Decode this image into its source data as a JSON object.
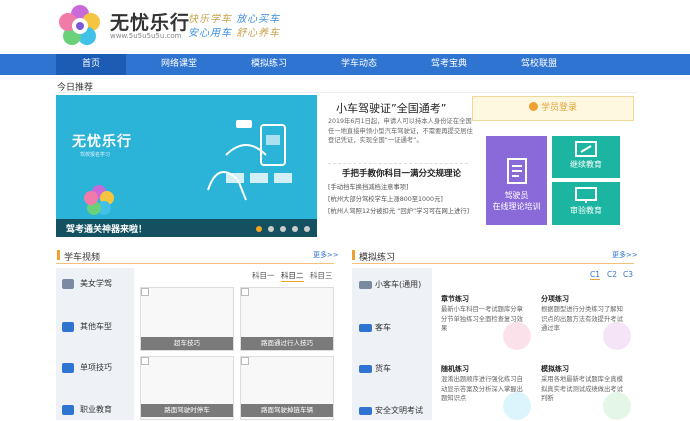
{
  "header": {
    "brand": "无忧乐行",
    "site": "www.5u5u5u5u.com",
    "slogan_line1_a": "快乐学车",
    "slogan_line1_b": "放心买车",
    "slogan_line2_a": "安心用车",
    "slogan_line2_b": "舒心养车"
  },
  "nav": {
    "items": [
      {
        "label": "首页"
      },
      {
        "label": "网络课堂"
      },
      {
        "label": "模拟练习"
      },
      {
        "label": "学车动态"
      },
      {
        "label": "驾考宝典"
      },
      {
        "label": "驾校联盟"
      }
    ]
  },
  "today": {
    "label": "今日推荐"
  },
  "banner": {
    "title": "无忧乐行",
    "subtitle": "驾校报名学习",
    "caption": "驾考通关神器来啦！"
  },
  "news": {
    "headline": "小车驾驶证”全国通考”",
    "summary": "2019年6月1日起，申请人可以持本人身份证在全国任一地直接申领小型汽车驾驶证，不需要再提交居住登记凭证，实现全国“一证通考”。",
    "headline2": "手把手教你科目一满分交规理论",
    "items": [
      "[手动挡车换挡减档注意事项]",
      "[杭州大部分驾校学车上涨800至1000元]",
      "[杭州人驾照12分被扣光 “回炉”学习可在网上进行]"
    ]
  },
  "login": {
    "label": "学员登录"
  },
  "tiles": {
    "a_line1": "驾驶员",
    "a_line2": "在线理论培训",
    "b": "继续教育",
    "c": "审验教育"
  },
  "video": {
    "title": "学车视频",
    "more": "更多>>",
    "tabs": [
      {
        "label": "科目一"
      },
      {
        "label": "科目二"
      },
      {
        "label": "科目三"
      }
    ],
    "side": [
      {
        "label": "美女学驾"
      },
      {
        "label": "其他车型"
      },
      {
        "label": "单项技巧"
      },
      {
        "label": "职业教育"
      }
    ],
    "thumbs": [
      {
        "caption": "超车技巧"
      },
      {
        "caption": "路面通过行人技巧"
      },
      {
        "caption": "路面驾驶时停车"
      },
      {
        "caption": "路面驾驶掉链车辆"
      }
    ]
  },
  "practice": {
    "title": "模拟练习",
    "more": "更多>>",
    "tabs": [
      {
        "label": "C1"
      },
      {
        "label": "C2"
      },
      {
        "label": "C3"
      }
    ],
    "side": [
      {
        "label": "小客车(通用)"
      },
      {
        "label": "客车"
      },
      {
        "label": "货车"
      },
      {
        "label": "安全文明考试"
      }
    ],
    "cards": [
      {
        "title": "章节练习",
        "desc": "最新小车科目一考试题库分章分节单独练习全面检查复习效果"
      },
      {
        "title": "分项练习",
        "desc": "根据题型进行分类练习了解知识点的出题方法有效提升考试通过率"
      },
      {
        "title": "随机练习",
        "desc": "混淆出题顺序进行强化练习自动显示答案及分析深入掌握出题知识点"
      },
      {
        "title": "模拟练习",
        "desc": "采用各地最新考试题库全真模拟真实考试测试成绩做出考试判断"
      }
    ]
  },
  "colors": {
    "nav": "#2f74d0",
    "accent": "#f0a030",
    "tile_purple": "#8a6ad8",
    "tile_teal": "#1bb5a1"
  }
}
